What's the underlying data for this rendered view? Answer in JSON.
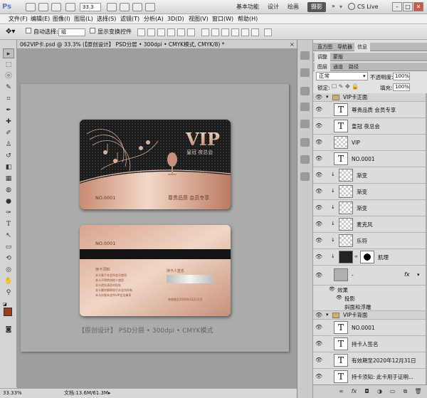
{
  "app": {
    "logo": "Ps",
    "zoom": "33.3",
    "workspaces": [
      "基本功能",
      "设计",
      "绘画",
      "摄影"
    ],
    "active_workspace": "摄影",
    "cs_live": "CS Live",
    "window_controls": [
      "-",
      "□",
      "✕"
    ]
  },
  "menu": [
    "文件(F)",
    "编辑(E)",
    "图像(I)",
    "图层(L)",
    "选择(S)",
    "滤镜(T)",
    "分析(A)",
    "3D(D)",
    "视图(V)",
    "窗口(W)",
    "帮助(H)"
  ],
  "options": {
    "auto_select_label": "自动选择:",
    "auto_select_value": "组",
    "show_transform_label": "显示变换控件"
  },
  "document": {
    "tab_title": "062VIP卡.psd @ 33.3% (【原创设计】    PSD分层 • 300dpi • CMYK模式, CMYK/8) *",
    "caption": "【原创设计】      PSD分层 • 300dpi • CMYK模式",
    "card_front": {
      "vip": "VIP",
      "club": "皇冠 夜总会",
      "number": "NO.0001",
      "slogan": "尊贵品质  会员专享"
    },
    "card_back": {
      "number": "NO.0001",
      "notice_title": "持卡须知:",
      "notice_lines": [
        "本卡限于本会所会员使用",
        "本卡不得转借他人使用",
        "本卡遗失请及时挂失",
        "本卡最终解释权归本会所所有",
        "本卡仅限本会所VIP会员尊享"
      ],
      "sign_label": "持卡人签名",
      "valid": "有效期至2020年12月31日"
    }
  },
  "status": {
    "zoom": "33.33%",
    "doc_size": "文档:13.6M/61.3M"
  },
  "panels": {
    "tabs_row1": [
      "直方图",
      "导航器",
      "信息"
    ],
    "tabs_row2": [
      "调整",
      "蒙版"
    ],
    "tabs_row3": [
      "图层",
      "通道",
      "路径"
    ],
    "blend_mode": "正常",
    "opacity_label": "不透明度:",
    "opacity": "100%",
    "lock_label": "锁定:",
    "fill_label": "填充:",
    "fill": "100%"
  },
  "layers": {
    "group_front": "VIP卡正面",
    "front_items": [
      {
        "kind": "T",
        "name": "尊贵品质  会员专享"
      },
      {
        "kind": "T",
        "name": "皇冠 夜总会"
      },
      {
        "kind": "img",
        "name": "VIP"
      },
      {
        "kind": "T",
        "name": "NO.0001"
      },
      {
        "kind": "img",
        "name": "渐变"
      },
      {
        "kind": "img",
        "name": "渐变"
      },
      {
        "kind": "img",
        "name": "渐变"
      },
      {
        "kind": "img",
        "name": "麦克风"
      },
      {
        "kind": "img",
        "name": "乐符"
      },
      {
        "kind": "img",
        "name": "肌理"
      }
    ],
    "bg_layer": "-",
    "fx_label": "fx",
    "effects_label": "效果",
    "effect_1": "投影",
    "effect_2": "斜面和浮雕",
    "group_back": "VIP卡背面",
    "back_items": [
      {
        "kind": "T",
        "name": "NO.0001"
      },
      {
        "kind": "T",
        "name": "持卡人签名"
      },
      {
        "kind": "T",
        "name": "有效期至2020年12月31日"
      },
      {
        "kind": "T",
        "name": "持卡须知:  此卡用于证明..."
      }
    ]
  }
}
